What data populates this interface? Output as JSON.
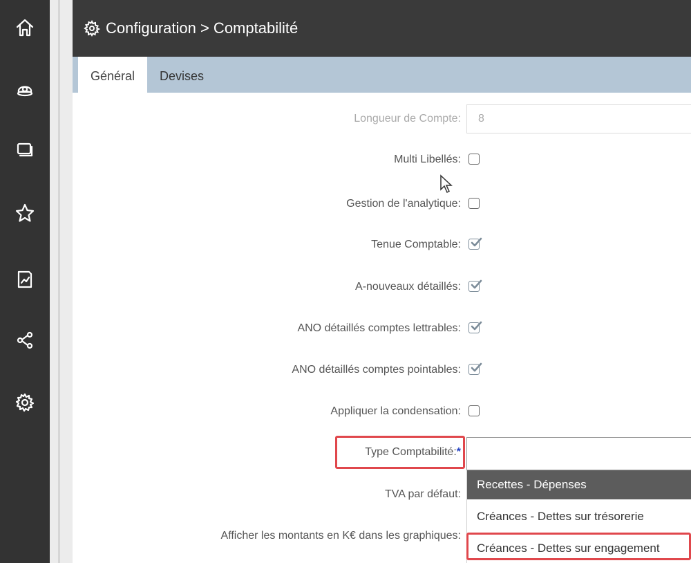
{
  "sidebar": {
    "icons": [
      "home-icon",
      "piggy-bank-icon",
      "cards-icon",
      "star-icon",
      "report-chart-icon",
      "share-icon",
      "settings-icon"
    ]
  },
  "header": {
    "icon": "gear-icon",
    "title": "Configuration > Comptabilité"
  },
  "tabs": [
    {
      "label": "Général",
      "active": true
    },
    {
      "label": "Devises",
      "active": false
    }
  ],
  "form": {
    "longueur_compte": {
      "label": "Longueur de Compte:",
      "value": "8"
    },
    "multi_libelles": {
      "label": "Multi Libellés:",
      "checked": false
    },
    "gestion_analytique": {
      "label": "Gestion de l'analytique:",
      "checked": false
    },
    "tenue_comptable": {
      "label": "Tenue Comptable:",
      "checked": true
    },
    "a_nouveaux": {
      "label": "A-nouveaux détaillés:",
      "checked": true
    },
    "ano_lettrables": {
      "label": "ANO détaillés comptes lettrables:",
      "checked": true
    },
    "ano_pointables": {
      "label": "ANO détaillés comptes pointables:",
      "checked": true
    },
    "condensation": {
      "label": "Appliquer la condensation:",
      "checked": false
    },
    "type_comptabilite": {
      "label": "Type Comptabilité:",
      "required_mark": "*",
      "value": ""
    },
    "tva_defaut": {
      "label": "TVA par défaut:"
    },
    "montants_k": {
      "label": "Afficher les montants en K€ dans les graphiques:"
    }
  },
  "dropdown": {
    "options": [
      "Recettes - Dépenses",
      "Créances - Dettes sur trésorerie",
      "Créances - Dettes sur engagement"
    ],
    "highlighted_index": 0
  },
  "colors": {
    "rail": "#333333",
    "header": "#3a3a3a",
    "tabbar": "#b4c6d6",
    "highlight_box": "#e0474c",
    "required_star": "#1f3ec2"
  }
}
